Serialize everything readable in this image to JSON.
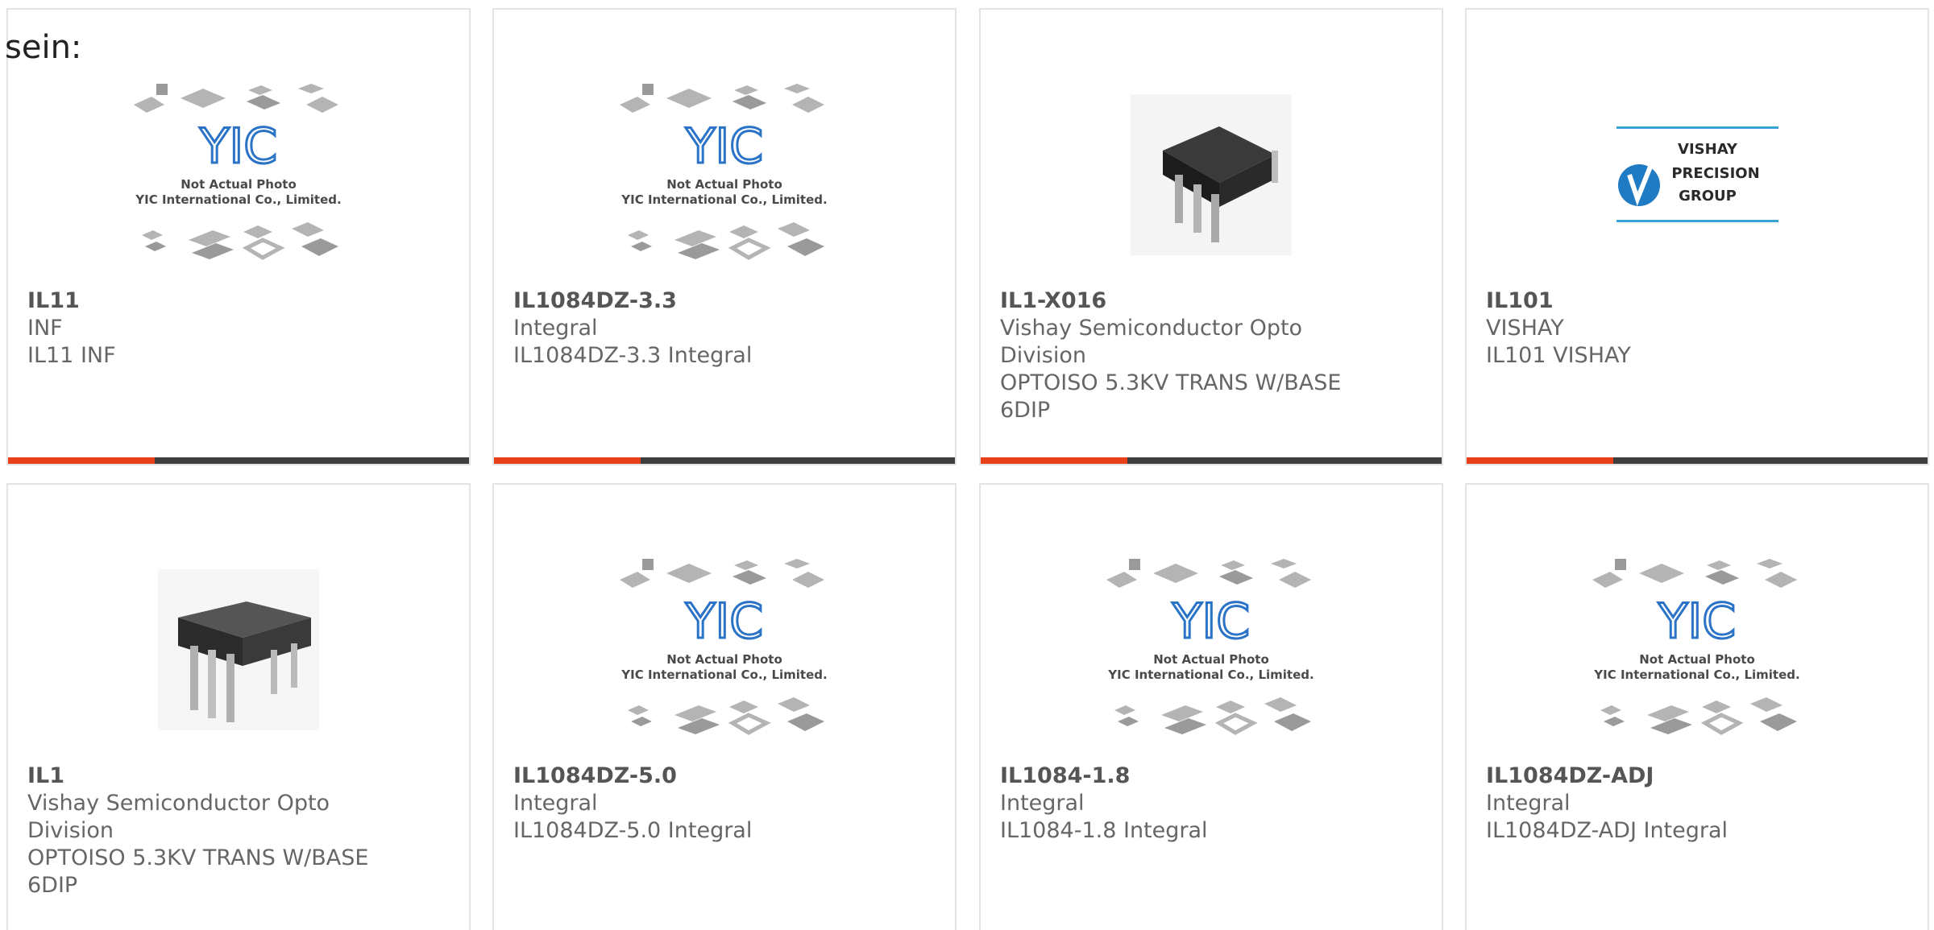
{
  "header": {
    "text": "sein:"
  },
  "placeholder": {
    "line1": "Not Actual Photo",
    "line2": "YIC International Co., Limited.",
    "logo_text": "YIC"
  },
  "vishay_logo": {
    "line1": "VISHAY",
    "line2": "PRECISION",
    "line3": "GROUP"
  },
  "colors": {
    "accent": "#e8401b",
    "bar": "#3e3e3e",
    "text": "#666666",
    "border": "#e3e3e3",
    "yic_blue": "#2a73c6"
  },
  "products": [
    {
      "part": "IL11",
      "manufacturer": "INF",
      "description": "IL11 INF",
      "image": "placeholder-photo"
    },
    {
      "part": "IL1084DZ-3.3",
      "manufacturer": "Integral",
      "description": "IL1084DZ-3.3 Integral",
      "image": "placeholder-photo"
    },
    {
      "part": "IL1-X016",
      "manufacturer": "Vishay Semiconductor Opto Division",
      "description": "OPTOISO 5.3KV TRANS W/BASE 6DIP",
      "image": "dip-chip-photo"
    },
    {
      "part": "IL101",
      "manufacturer": "VISHAY",
      "description": "IL101 VISHAY",
      "image": "vishay-logo"
    },
    {
      "part": "IL1",
      "manufacturer": "Vishay Semiconductor Opto Division",
      "description": "OPTOISO 5.3KV TRANS W/BASE 6DIP",
      "image": "dip-chip-photo"
    },
    {
      "part": "IL1084DZ-5.0",
      "manufacturer": "Integral",
      "description": "IL1084DZ-5.0 Integral",
      "image": "placeholder-photo"
    },
    {
      "part": "IL1084-1.8",
      "manufacturer": "Integral",
      "description": "IL1084-1.8 Integral",
      "image": "placeholder-photo"
    },
    {
      "part": "IL1084DZ-ADJ",
      "manufacturer": "Integral",
      "description": "IL1084DZ-ADJ Integral",
      "image": "placeholder-photo"
    }
  ]
}
